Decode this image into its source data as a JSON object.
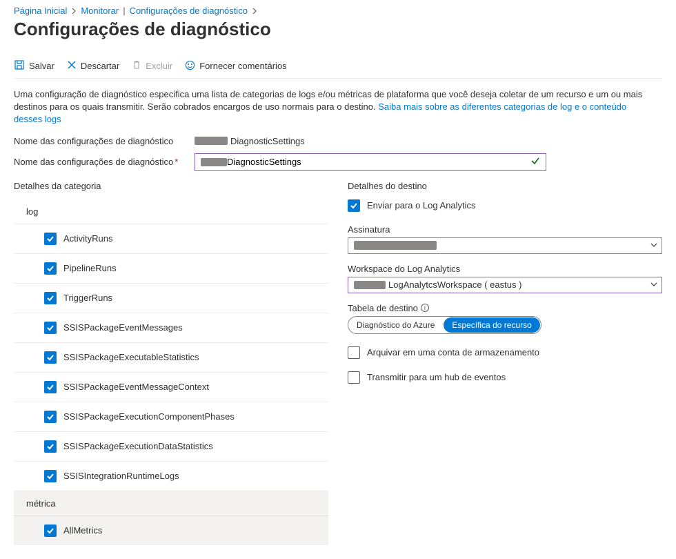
{
  "breadcrumb": {
    "home": "Página Inicial",
    "monitor": "Monitorar",
    "diag": "Configurações de diagnóstico"
  },
  "title": "Configurações de diagnóstico",
  "toolbar": {
    "save": "Salvar",
    "discard": "Descartar",
    "delete": "Excluir",
    "feedback": "Fornecer comentários"
  },
  "description": {
    "text": "Uma configuração de diagnóstico especifica uma lista de categorias de logs e/ou métricas de plataforma que você deseja coletar de um recurso e um ou mais destinos para os quais transmitir. Serão cobrados encargos de uso normais para o destino. ",
    "link": "Saiba mais sobre as diferentes categorias de log e o conteúdo desses logs"
  },
  "form": {
    "name_label": "Nome das configurações de diagnóstico",
    "readonly_value_suffix": "DiagnosticSettings",
    "input_value_suffix": "DiagnosticSettings"
  },
  "categories": {
    "heading": "Detalhes da categoria",
    "log_heading": "log",
    "logs": [
      "ActivityRuns",
      "PipelineRuns",
      "TriggerRuns",
      "SSISPackageEventMessages",
      "SSISPackageExecutableStatistics",
      "SSISPackageEventMessageContext",
      "SSISPackageExecutionComponentPhases",
      "SSISPackageExecutionDataStatistics",
      "SSISIntegrationRuntimeLogs"
    ],
    "metric_heading": "métrica",
    "metrics": [
      "AllMetrics"
    ]
  },
  "destination": {
    "heading": "Detalhes do destino",
    "send_la": "Enviar para o Log Analytics",
    "subscription_label": "Assinatura",
    "workspace_label": "Workspace do Log Analytics",
    "workspace_value_suffix": "LogAnalytcsWorkspace ( eastus )",
    "target_table_label": "Tabela de destino",
    "toggle_azure": "Diagnóstico do Azure",
    "toggle_resource": "Específica do recurso",
    "archive_storage": "Arquivar em uma conta de armazenamento",
    "stream_eventhub": "Transmitir para um hub de eventos"
  }
}
